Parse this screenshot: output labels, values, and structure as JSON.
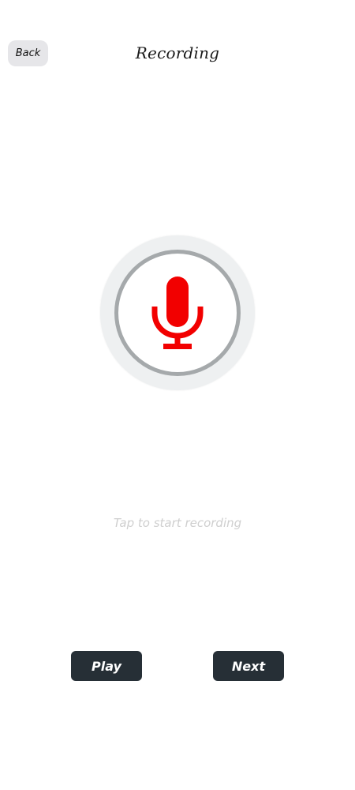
{
  "header": {
    "back_label": "Back",
    "title": "Recording"
  },
  "recorder": {
    "icon": "microphone-icon",
    "accent_color": "#f20000",
    "hint": "Tap to start recording"
  },
  "actions": {
    "play_label": "Play",
    "next_label": "Next"
  }
}
